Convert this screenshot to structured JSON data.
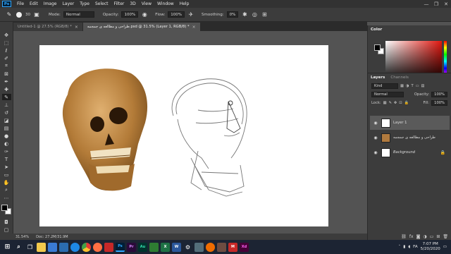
{
  "menubar": {
    "logo": "Ps",
    "items": [
      "File",
      "Edit",
      "Image",
      "Layer",
      "Type",
      "Select",
      "Filter",
      "3D",
      "View",
      "Window",
      "Help"
    ],
    "controls": [
      "—",
      "❐",
      "✕"
    ]
  },
  "options": {
    "brush_size": "30",
    "mode_label": "Mode:",
    "mode_value": "Normal",
    "opacity_label": "Opacity:",
    "opacity_value": "100%",
    "flow_label": "Flow:",
    "flow_value": "100%",
    "smoothing_label": "Smoothing:",
    "smoothing_value": "0%"
  },
  "tabs": [
    {
      "label": "Untitled-1 @ 27.5% (RGB/8) *",
      "close": "×"
    },
    {
      "label": "طراحی و مطالعه ی جمجمه.psd @ 31.5% (Layer 1, RGB/8) *",
      "close": "×"
    }
  ],
  "status": {
    "zoom": "31.54%",
    "doc": "Doc: 27.2M/31.9M"
  },
  "color_panel": {
    "title": "Color",
    "fg": "#000000",
    "bg": "#ffffff",
    "accent": "#e2170f"
  },
  "layers_panel": {
    "tab_layers": "Layers",
    "tab_channels": "Channels",
    "kind": "Kind",
    "blend": "Normal",
    "opacity_label": "Opacity:",
    "opacity_value": "100%",
    "lock_label": "Lock:",
    "fill_label": "Fill:",
    "fill_value": "100%",
    "layers": [
      {
        "name": "Layer 1",
        "active": true,
        "thumb": "white"
      },
      {
        "name": "طراحی و مطالعه ی جمجمه",
        "active": false,
        "thumb": "skull"
      },
      {
        "name": "Background",
        "active": false,
        "thumb": "white",
        "locked": true
      }
    ],
    "bottom_icons": [
      "link-icon",
      "fx-icon",
      "mask-icon",
      "adjustment-icon",
      "folder-icon",
      "new-layer-icon",
      "trash-icon"
    ]
  },
  "taskbar": {
    "language": "FA",
    "time": "7:07 PM",
    "date": "5/20/2020",
    "apps": [
      "windows-icon",
      "search-icon",
      "task-view-icon",
      "explorer-icon",
      "store-icon",
      "mail-icon",
      "edge-icon",
      "chrome-icon",
      "firefox-icon",
      "pdf-icon",
      "ps-icon",
      "pr-icon",
      "au-icon",
      "cam-icon",
      "excel-icon",
      "word-icon",
      "settings-icon",
      "media-icon",
      "player-icon",
      "app-icon",
      "mcafee-icon",
      "xd-icon"
    ]
  }
}
